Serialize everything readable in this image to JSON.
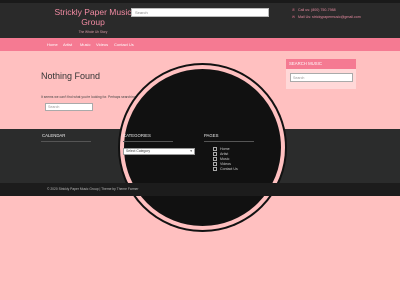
{
  "header": {
    "site_title_line1": "Strickly Paper Music",
    "site_title_line2": "Group",
    "tagline": "The Whole Uh Story",
    "search_placeholder": "Search",
    "phone": "Call us: (800) 750-7988",
    "email": "Mail Us: strickypapermusic@gmail.com",
    "phone_icon": "phone-icon",
    "email_icon": "envelope-icon"
  },
  "nav": {
    "items": [
      {
        "label": "Home"
      },
      {
        "label": "Artist"
      },
      {
        "label": "Music"
      },
      {
        "label": "Videos"
      },
      {
        "label": "Contact Us"
      }
    ]
  },
  "main": {
    "title": "Nothing Found",
    "message": "It seems we can't find what you're looking for. Perhaps searching can help.",
    "search_placeholder": "Search"
  },
  "sidebar": {
    "title": "SEARCH MUSIC",
    "search_placeholder": "Search"
  },
  "footer": {
    "calendar_title": "CALENDAR",
    "categories_title": "CATEGORIES",
    "categories_select": "Select Category",
    "pages_title": "PAGES",
    "pages": [
      {
        "label": "Home"
      },
      {
        "label": "Artist"
      },
      {
        "label": "Music"
      },
      {
        "label": "Videos"
      },
      {
        "label": "Contact Us"
      }
    ],
    "copyright": "© 2020 Strickly Paper Music Group | Theme by Theme Farmer"
  },
  "colors": {
    "background": "#ffc0c0",
    "accent": "#f57a92",
    "dark": "#2b2c2c"
  }
}
